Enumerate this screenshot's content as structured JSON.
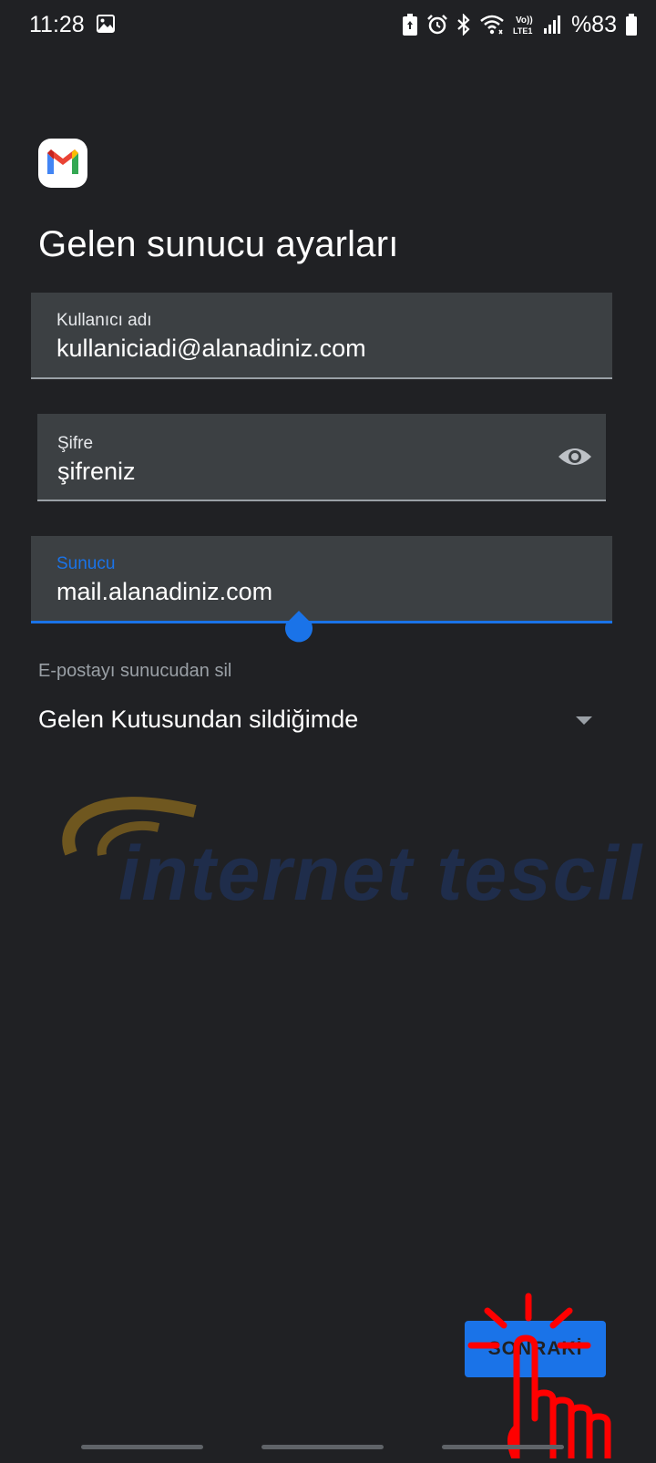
{
  "status_bar": {
    "time": "11:28",
    "battery": "%83",
    "network_label": "Vo)) LTE1",
    "icons": [
      "gallery-icon",
      "battery-saver-icon",
      "alarm-icon",
      "bluetooth-icon",
      "wifi-icon",
      "volte-icon",
      "signal-icon",
      "battery-icon"
    ]
  },
  "app": {
    "logo_icon": "gmail-icon"
  },
  "title": "Gelen sunucu ayarları",
  "fields": {
    "username": {
      "label": "Kullanıcı adı",
      "value": "kullaniciadi@alanadiniz.com"
    },
    "password": {
      "label": "Şifre",
      "value": "şifreniz",
      "icon": "eye-icon"
    },
    "server": {
      "label": "Sunucu",
      "value": "mail.alanadiniz.com"
    }
  },
  "delete_setting": {
    "label": "E-postayı sunucudan sil",
    "value": "Gelen Kutusundan sildiğimde"
  },
  "watermark": {
    "text": "internet tescil"
  },
  "next_button": {
    "label": "SONRAKİ"
  },
  "colors": {
    "background": "#202124",
    "field_background": "#3c4043",
    "accent": "#1a73e8",
    "tap_indicator": "#ff0000"
  }
}
